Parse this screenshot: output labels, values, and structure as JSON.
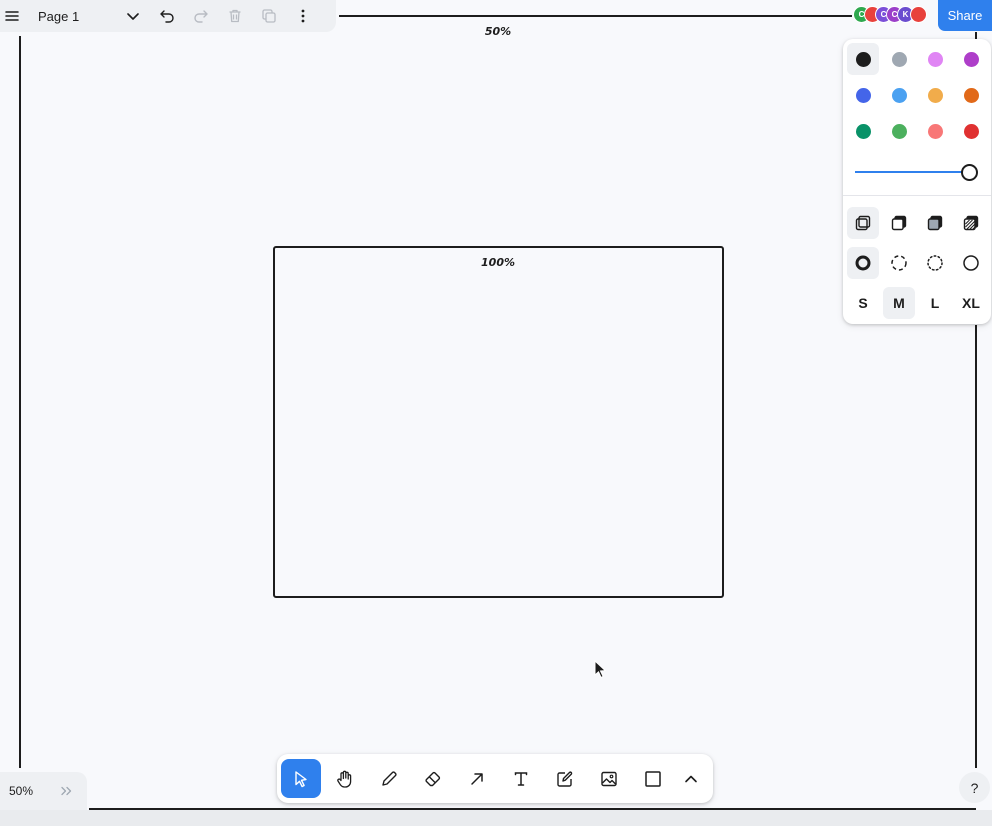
{
  "menu": {
    "page_name": "Page 1"
  },
  "canvas": {
    "outer_frame_label": "50%",
    "inner_frame_label": "100%"
  },
  "collaborators": [
    {
      "initial": "C",
      "color": "#2fa84f"
    },
    {
      "initial": "",
      "color": "#e8413c"
    },
    {
      "initial": "C",
      "color": "#7b4fd8"
    },
    {
      "initial": "C",
      "color": "#9b3fc9"
    },
    {
      "initial": "K",
      "color": "#6a4ccf"
    },
    {
      "initial": "",
      "color": "#e8413c"
    }
  ],
  "share": {
    "label": "Share"
  },
  "style_panel": {
    "colors": [
      "#1d1d1d",
      "#9fa8b2",
      "#e085f4",
      "#ae3ec9",
      "#4465e9",
      "#4ba1f1",
      "#f1ac4b",
      "#e16919",
      "#099268",
      "#4cb05e",
      "#f87777",
      "#e03131"
    ],
    "selected_color": "#1d1d1d",
    "opacity_percent": 100,
    "sizes": [
      "S",
      "M",
      "L",
      "XL"
    ],
    "selected_size": "M"
  },
  "zoom": {
    "value": "50%"
  },
  "help": {
    "label": "?"
  },
  "accent_color": "#2f80ed"
}
